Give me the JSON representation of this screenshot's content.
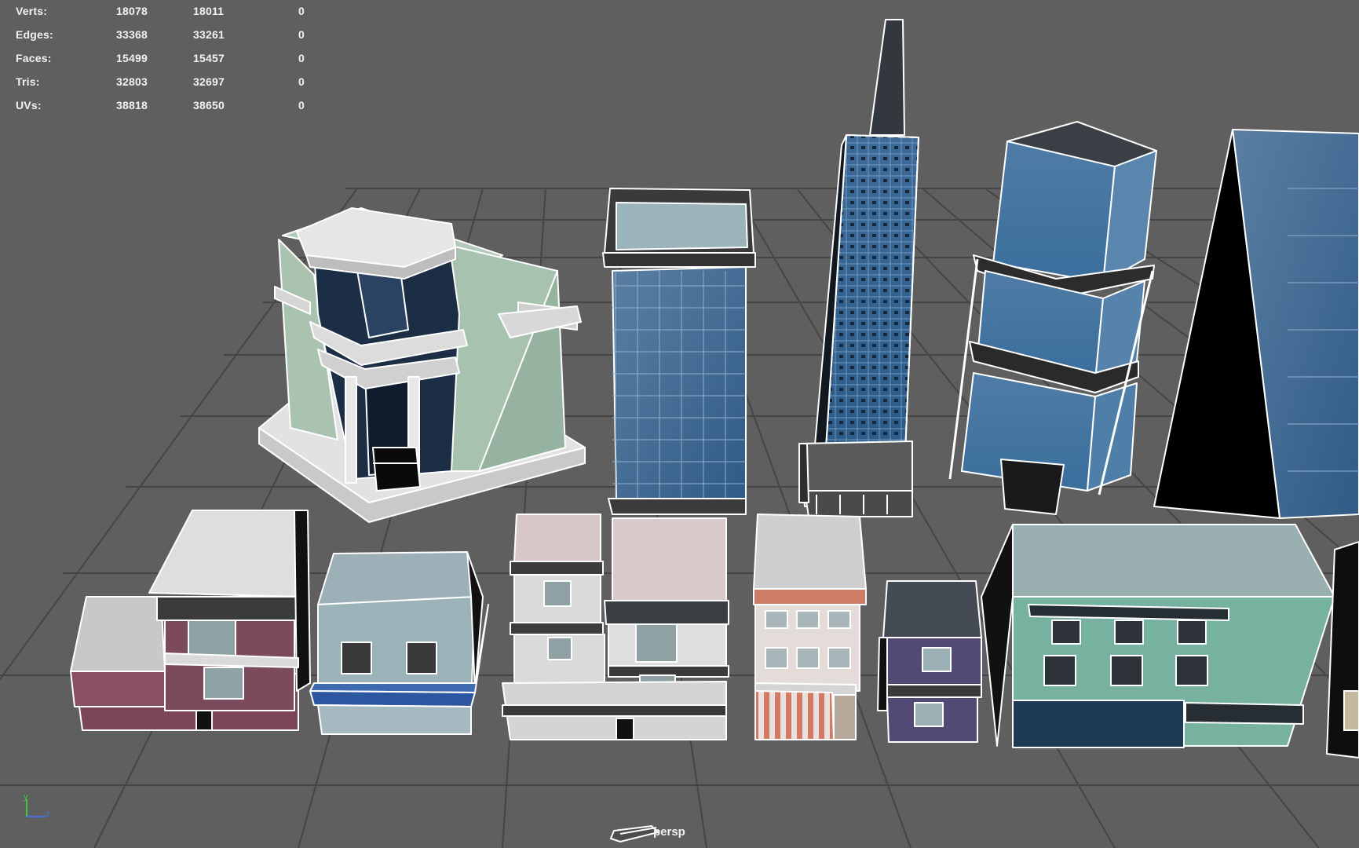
{
  "stats": {
    "rows": [
      {
        "label": "Verts:",
        "v1": "18078",
        "v2": "18011",
        "v3": "0"
      },
      {
        "label": "Edges:",
        "v1": "33368",
        "v2": "33261",
        "v3": "0"
      },
      {
        "label": "Faces:",
        "v1": "15499",
        "v2": "15457",
        "v3": "0"
      },
      {
        "label": "Tris:",
        "v1": "32803",
        "v2": "32697",
        "v3": "0"
      },
      {
        "label": "UVs:",
        "v1": "38818",
        "v2": "38650",
        "v3": "0"
      }
    ]
  },
  "camera": {
    "label": "persp"
  },
  "axis": {
    "y_label": "y",
    "z_label": "z"
  },
  "colors": {
    "background": "#5f5f5f",
    "grid": "#3f3f3f",
    "wireframe": "#ffffff",
    "hud_text": "#f2f2f2"
  }
}
